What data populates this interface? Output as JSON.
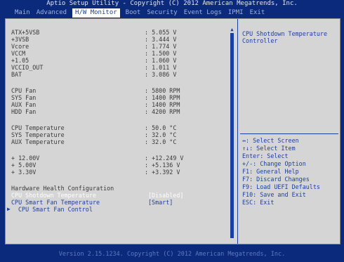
{
  "header": {
    "title": "Aptio Setup Utility - Copyright (C) 2012 American Megatrends, Inc."
  },
  "tabs": [
    {
      "label": "Main"
    },
    {
      "label": "Advanced"
    },
    {
      "label": "H/W Monitor"
    },
    {
      "label": "Boot"
    },
    {
      "label": "Security"
    },
    {
      "label": "Event Logs"
    },
    {
      "label": "IPMI"
    },
    {
      "label": "Exit"
    }
  ],
  "active_tab": "H/W Monitor",
  "voltages": [
    {
      "label": "ATX+5VSB",
      "value": ": 5.055 V"
    },
    {
      "label": "+3VSB",
      "value": ": 3.444 V"
    },
    {
      "label": "Vcore",
      "value": ": 1.774 V"
    },
    {
      "label": "VCCM",
      "value": ": 1.500 V"
    },
    {
      "label": "+1.05",
      "value": ": 1.060 V"
    },
    {
      "label": "VCCIO_OUT",
      "value": ": 1.011 V"
    },
    {
      "label": "BAT",
      "value": ": 3.086 V"
    }
  ],
  "fans": [
    {
      "label": "CPU Fan",
      "value": ": 5800 RPM"
    },
    {
      "label": "SYS Fan",
      "value": ": 1400 RPM"
    },
    {
      "label": "AUX Fan",
      "value": ": 1400 RPM"
    },
    {
      "label": "HDD Fan",
      "value": ": 4200 RPM"
    }
  ],
  "temperatures": [
    {
      "label": "CPU Temperature",
      "value": ": 50.0 °C"
    },
    {
      "label": "SYS Temperature",
      "value": ": 32.0 °C"
    },
    {
      "label": "AUX Temperature",
      "value": ": 32.0 °C"
    }
  ],
  "rails": [
    {
      "label": "+ 12.00V",
      "value": ": +12.249 V"
    },
    {
      "label": "+ 5.00V",
      "value": ": +5.136 V"
    },
    {
      "label": "+ 3.30V",
      "value": ": +3.392 V"
    }
  ],
  "config": {
    "heading": "Hardware Health Configuration",
    "shutdown_label": "CPU Shotdown Temperature",
    "shutdown_value": "[Disabled]",
    "smartfan_label": "CPU Smart Fan Temperature",
    "smartfan_value": "[Smart]",
    "control_label": "CPU Smart Fan Control"
  },
  "help": {
    "description": "CPU Shotdown Temperature Controller"
  },
  "keys": [
    "↔: Select Screen",
    "↑↓: Select Item",
    "Enter: Select",
    "+/-: Change Option",
    "F1: General Help",
    "F7: Discard Changes",
    "F9: Load UEFI Defaults",
    "F10: Save and Exit",
    "ESC: Exit"
  ],
  "footer": {
    "text": "Version 2.15.1234. Copyright (C) 2012 American Megatrends, Inc."
  },
  "colors": {
    "background": "#0c2a7c",
    "panel": "#d5d5d5",
    "accent": "#1a3fa0",
    "highlight": "#ffffff"
  }
}
